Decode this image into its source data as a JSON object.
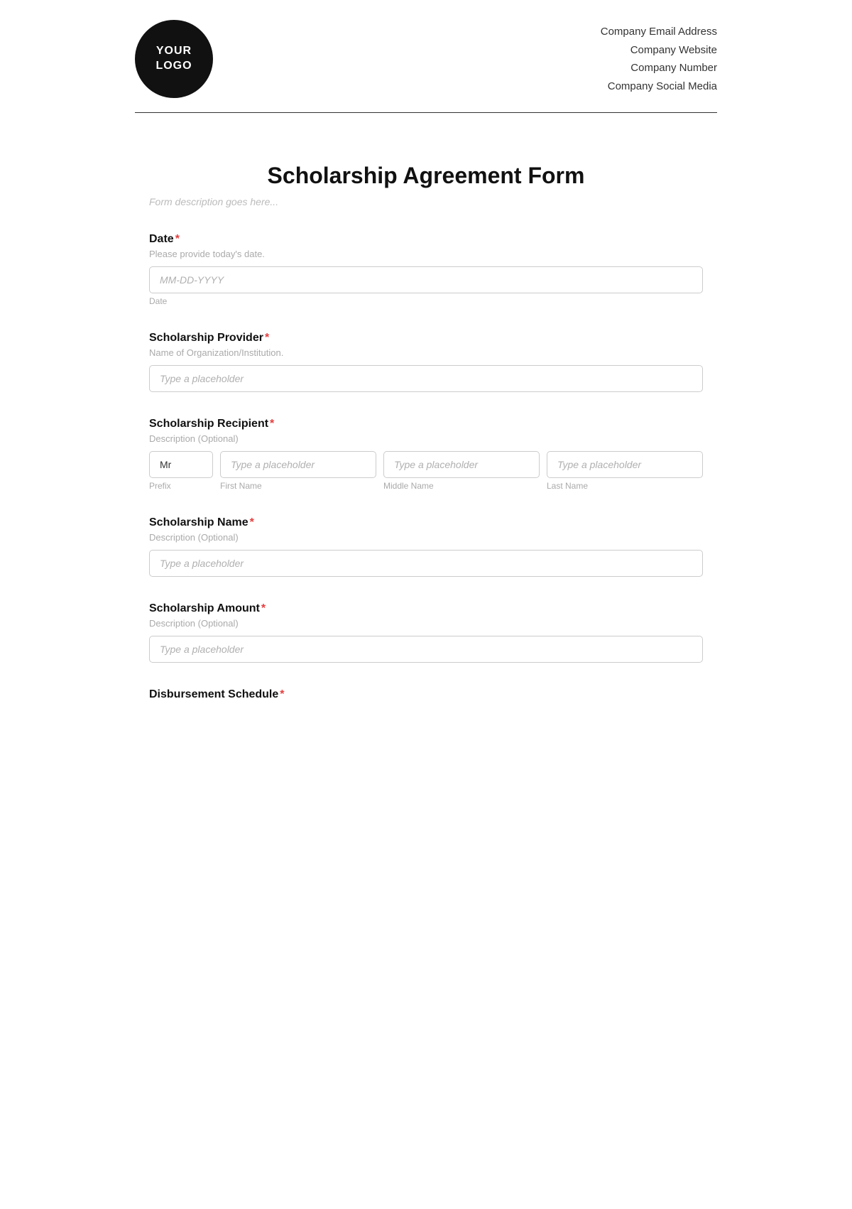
{
  "header": {
    "logo_line1": "YOUR",
    "logo_line2": "LOGO",
    "company_email": "Company Email Address",
    "company_website": "Company Website",
    "company_number": "Company Number",
    "company_social": "Company Social Media"
  },
  "form": {
    "title": "Scholarship Agreement Form",
    "description": "Form description goes here...",
    "fields": {
      "date": {
        "label": "Date",
        "hint": "Please provide today's date.",
        "placeholder": "MM-DD-YYYY",
        "note": "Date"
      },
      "scholarship_provider": {
        "label": "Scholarship Provider",
        "hint": "Name of Organization/Institution.",
        "placeholder": "Type a placeholder"
      },
      "scholarship_recipient": {
        "label": "Scholarship Recipient",
        "hint": "Description (Optional)",
        "prefix_value": "Mr",
        "prefix_label": "Prefix",
        "first_name_placeholder": "Type a placeholder",
        "first_name_label": "First Name",
        "middle_name_placeholder": "Type a placeholder",
        "middle_name_label": "Middle Name",
        "last_name_placeholder": "Type a placeholder",
        "last_name_label": "Last Name"
      },
      "scholarship_name": {
        "label": "Scholarship Name",
        "hint": "Description (Optional)",
        "placeholder": "Type a placeholder"
      },
      "scholarship_amount": {
        "label": "Scholarship Amount",
        "hint": "Description (Optional)",
        "placeholder": "Type a placeholder"
      },
      "disbursement_schedule": {
        "label": "Disbursement Schedule"
      }
    }
  }
}
